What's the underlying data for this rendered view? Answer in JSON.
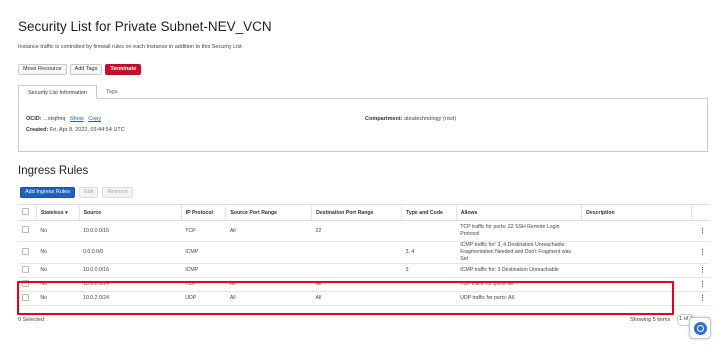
{
  "page": {
    "title": "Security List for Private Subnet-NEV_VCN",
    "subtitle": "Instance traffic is controlled by firewall rules on each Instance in addition to this Security List"
  },
  "actions": {
    "move_resource": "Move Resource",
    "add_tags": "Add Tags",
    "terminate": "Terminate"
  },
  "tabs": [
    {
      "label": "Security List Information",
      "active": true
    },
    {
      "label": "Tags",
      "active": false
    }
  ],
  "info": {
    "ocid_label": "OCID:",
    "ocid_value": "...xkqfmq",
    "show_link": "Show",
    "copy_link": "Copy",
    "created_label": "Created:",
    "created_value": "Fri, Apr 8, 2022, 03:44:54 UTC",
    "compartment_label": "Compartment:",
    "compartment_value": "ateatechnology (root)"
  },
  "ingress": {
    "title": "Ingress Rules",
    "add_button": "Add Ingress Rules",
    "edit_button": "Edit",
    "remove_button": "Remove",
    "columns": [
      "",
      "Stateless",
      "Source",
      "IP Protocol",
      "Source Port Range",
      "Destination Port Range",
      "Type and Code",
      "Allows",
      "Description",
      ""
    ],
    "rows": [
      {
        "stateless": "No",
        "source": "10.0.0.0/16",
        "protocol": "TCP",
        "src_port": "All",
        "dst_port": "22",
        "type_code": "",
        "allows": "TCP traffic for ports: 22 SSH Remote Login Protocol",
        "description": ""
      },
      {
        "stateless": "No",
        "source": "0.0.0.0/0",
        "protocol": "ICMP",
        "src_port": "",
        "dst_port": "",
        "type_code": "3, 4",
        "allows": "ICMP traffic for: 3, 4 Destination Unreachable: Fragmentation Needed and Don't Fragment was Set",
        "description": ""
      },
      {
        "stateless": "No",
        "source": "10.0.0.0/16",
        "protocol": "ICMP",
        "src_port": "",
        "dst_port": "",
        "type_code": "3",
        "allows": "ICMP traffic for: 3 Destination Unreachable",
        "description": ""
      },
      {
        "stateless": "No",
        "source": "10.0.2.0/24",
        "protocol": "TCP",
        "src_port": "All",
        "dst_port": "All",
        "type_code": "",
        "allows": "TCP traffic for ports: All",
        "description": ""
      },
      {
        "stateless": "No",
        "source": "10.0.2.0/24",
        "protocol": "UDP",
        "src_port": "All",
        "dst_port": "All",
        "type_code": "",
        "allows": "UDP traffic for ports: All",
        "description": ""
      }
    ],
    "selected_text": "0 Selected",
    "showing_text": "Showing 5 items",
    "page_text": "1 of 1"
  },
  "colors": {
    "terminate": "#c8102e",
    "primary": "#1f5fbf",
    "highlight": "#e3001b"
  }
}
